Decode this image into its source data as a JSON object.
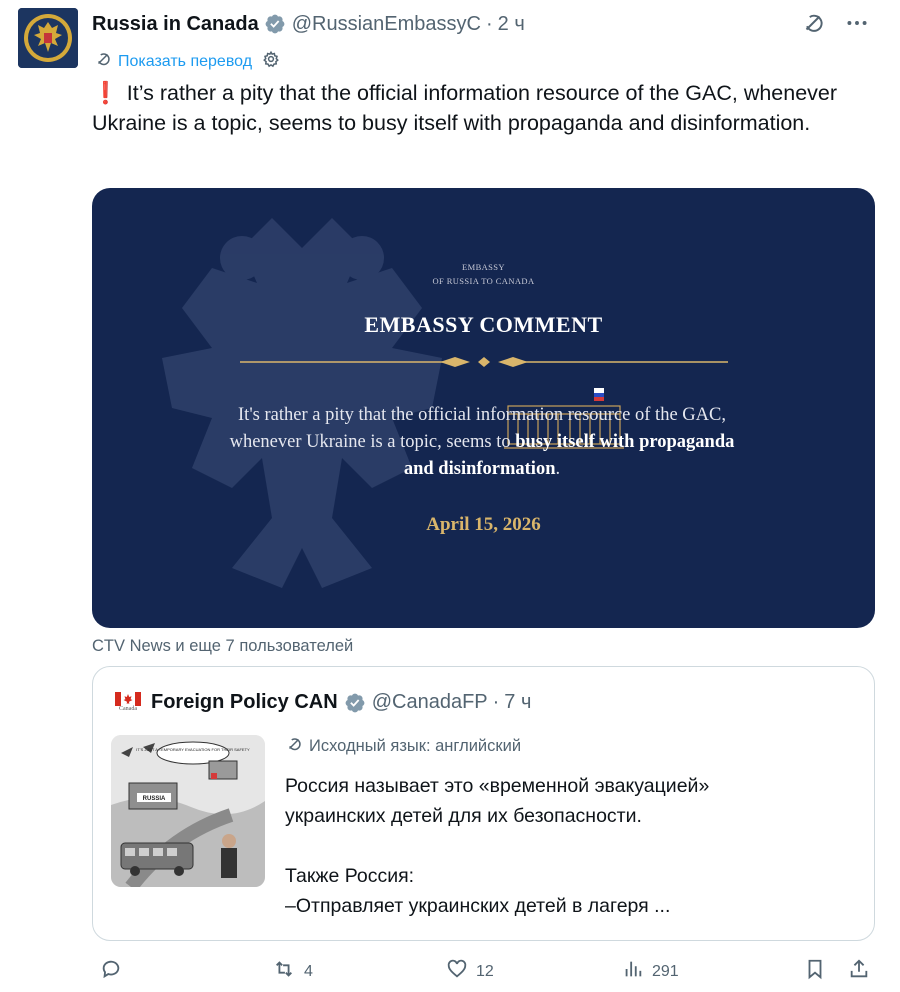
{
  "author": {
    "name": "Russia in Canada",
    "handle": "@RussianEmbassyC",
    "time": "2 ч",
    "verified": true
  },
  "translate_link": "Показать перевод",
  "tweet": {
    "alert_symbol": "❗",
    "text": "It’s rather a pity that the official information resource of the GAC, whenever Ukraine is a topic, seems to busy itself with propaganda and disinformation."
  },
  "media_card": {
    "org_line1": "EMBASSY",
    "org_line2": "OF RUSSIA TO CANADA",
    "title": "EMBASSY COMMENT",
    "body_line1": "It's rather a pity that the official information resource of the GAC,",
    "body_line2_plain": "whenever Ukraine is a topic, seems to ",
    "body_line2_bold": "busy itself with propaganda",
    "body_line3_bold": "and disinformation",
    "body_line3_end": ".",
    "date": "April 15, 2026",
    "background_color": "#142650",
    "accent_color": "#d9b56b"
  },
  "liked_by": "CTV News и еще 7 пользователей",
  "quoted": {
    "name": "Foreign Policy CAN",
    "handle": "@CanadaFP",
    "time": "7 ч",
    "verified": true,
    "flag_caption": "Canada",
    "source_language": "Исходный язык: английский",
    "lines": [
      "Россия называет это «временной эвакуацией»",
      "украинских детей для их безопасности.",
      "",
      "Также Россия:",
      "–Отправляет украинских детей в лагеря ..."
    ],
    "thumbnail_labels": {
      "speech": "IT'S JUST A TEMPORARY EVACUATION FOR THEIR SAFETY",
      "sign": "RUSSIA"
    }
  },
  "actions": {
    "replies": "",
    "reposts": "4",
    "likes": "12",
    "views": "291"
  },
  "icons": {
    "verified": "verified-badge-icon",
    "grok": "grok-icon",
    "more": "more-icon",
    "translate": "translate-icon",
    "settings": "gear-icon",
    "reply": "reply-icon",
    "repost": "repost-icon",
    "like": "heart-icon",
    "views": "views-icon",
    "bookmark": "bookmark-icon",
    "share": "share-icon"
  },
  "colors": {
    "link": "#1d9bf0",
    "muted": "#536471",
    "verified": "#829aab"
  }
}
